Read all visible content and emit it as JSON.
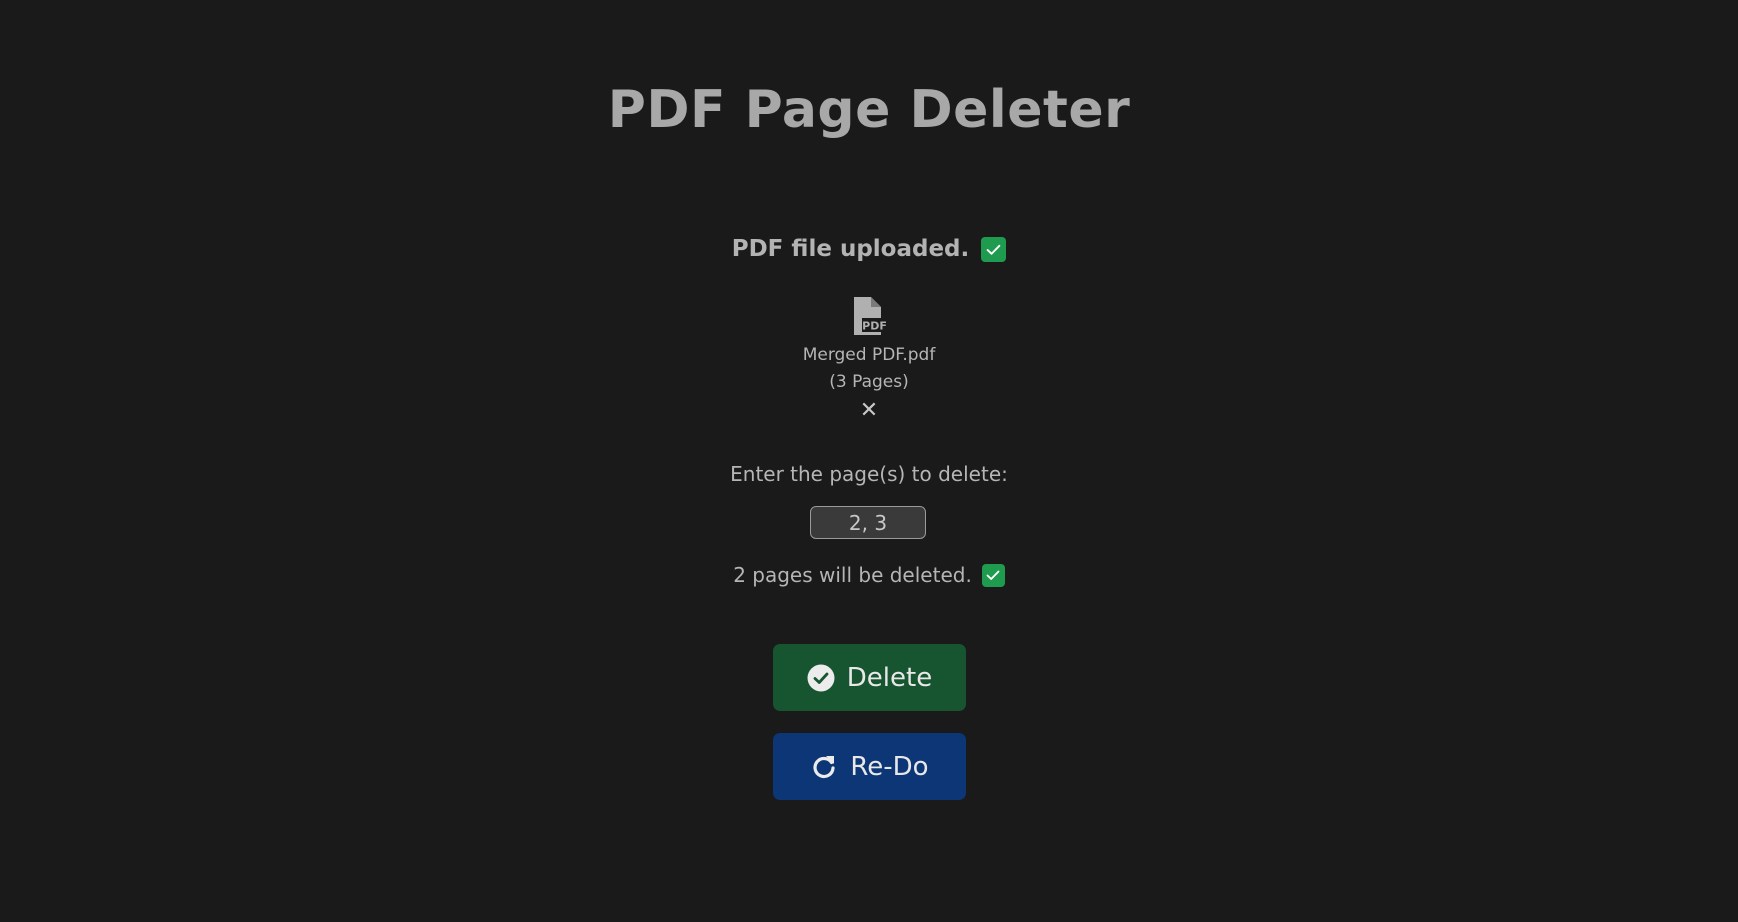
{
  "title": "PDF Page Deleter",
  "upload": {
    "status_text": "PDF file uploaded."
  },
  "file": {
    "icon_label": "PDF",
    "name": "Merged PDF.pdf",
    "pages": "(3 Pages)",
    "remove_symbol": "✕"
  },
  "delete_form": {
    "prompt": "Enter the page(s) to delete:",
    "input_value": "2, 3",
    "status_text": "2 pages will be deleted."
  },
  "buttons": {
    "delete_label": "Delete",
    "redo_label": "Re-Do"
  },
  "colors": {
    "background": "#1a1a1a",
    "check_green": "#1f9b4f",
    "delete_button": "#175430",
    "redo_button": "#0c3675"
  },
  "icons": {
    "upload_status": "check-icon",
    "file": "pdf-file-icon",
    "remove": "close-icon",
    "delete_status": "check-icon",
    "delete_button": "check-circle-icon",
    "redo_button": "redo-icon"
  }
}
